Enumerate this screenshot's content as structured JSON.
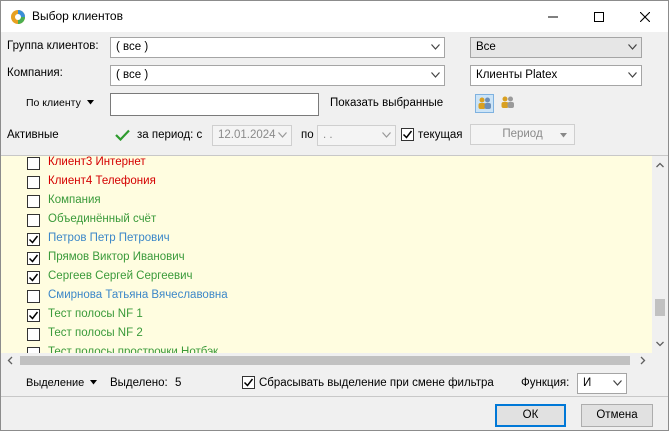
{
  "window": {
    "title": "Выбор клиентов"
  },
  "filters": {
    "group_label": "Группа клиентов:",
    "group_value": "( все )",
    "group_right_value": "Все",
    "company_label": "Компания:",
    "company_value": "( все )",
    "company_right_value": "Клиенты Platex",
    "by_client_label": "По клиенту",
    "by_client_value": "",
    "show_selected_label": "Показать выбранные",
    "active_label": "Активные",
    "period_label": "за период: с",
    "date_from": "12.01.2024",
    "to_label": "по",
    "date_to": " .  .",
    "current_label": "текущая",
    "period_button": "Период"
  },
  "clients": [
    {
      "name": "Клиент3 Интернет",
      "checked": false,
      "color": "#d40000"
    },
    {
      "name": "Клиент4 Телефония",
      "checked": false,
      "color": "#d40000"
    },
    {
      "name": "Компания",
      "checked": false,
      "color": "#3a9a3a"
    },
    {
      "name": "Объединённый счёт",
      "checked": false,
      "color": "#3a9a3a"
    },
    {
      "name": "Петров Петр Петрович",
      "checked": true,
      "color": "#3c87c8"
    },
    {
      "name": "Прямов Виктор Иванович",
      "checked": true,
      "color": "#3a9a3a"
    },
    {
      "name": "Сергеев Сергей Сергеевич",
      "checked": true,
      "color": "#3a9a3a"
    },
    {
      "name": "Смирнова Татьяна Вячеславовна",
      "checked": false,
      "color": "#3c87c8"
    },
    {
      "name": "Тест полосы NF 1",
      "checked": true,
      "color": "#3a9a3a"
    },
    {
      "name": "Тест полосы NF 2",
      "checked": false,
      "color": "#3a9a3a"
    },
    {
      "name": "Тест полосы прострочки Hотбэк",
      "checked": false,
      "color": "#3a9a3a"
    }
  ],
  "footer": {
    "selection_label": "Выделение",
    "selected_label": "Выделено:",
    "selected_count": "5",
    "reset_label": "Сбрасывать выделение при смене фильтра",
    "function_label": "Функция:",
    "function_value": "И",
    "ok": "ОК",
    "cancel": "Отмена"
  }
}
